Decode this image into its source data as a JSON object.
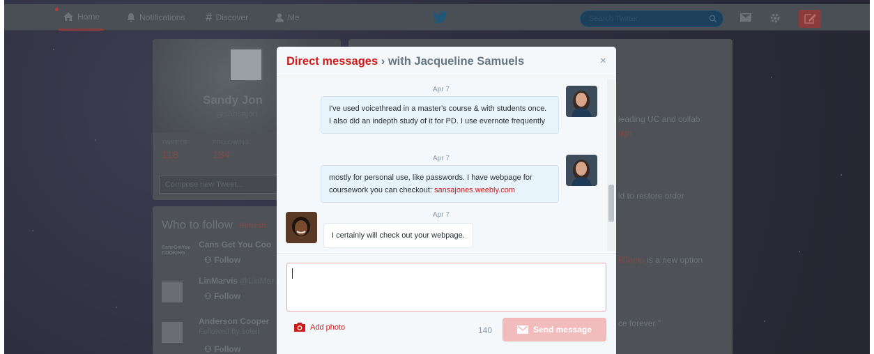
{
  "nav": {
    "items": [
      {
        "label": "Home",
        "icon": "home-icon"
      },
      {
        "label": "Notifications",
        "icon": "bell-icon"
      },
      {
        "label": "Discover",
        "icon": "hash-icon"
      },
      {
        "label": "Me",
        "icon": "person-icon"
      }
    ],
    "search_placeholder": "Search Twitter"
  },
  "profile": {
    "name": "Sandy Jon",
    "handle": "@sansajon",
    "stats": [
      {
        "label": "TWEETS",
        "value": "118"
      },
      {
        "label": "FOLLOWING",
        "value": "184"
      }
    ],
    "compose_placeholder": "Compose new Tweet..."
  },
  "who_to_follow": {
    "title": "Who to follow",
    "refresh": "Refresh",
    "items": [
      {
        "name": "Cans Get You Coo",
        "sub": "",
        "follow": "Follow",
        "avatar_text": "CansGetYou COOKING"
      },
      {
        "name": "LinMarvis",
        "sub": "@LinMar",
        "follow": "Follow"
      },
      {
        "name": "Anderson Cooper",
        "sub": "Followed by soleil",
        "follow": "Follow"
      }
    ]
  },
  "timeline": {
    "fragments": [
      {
        "text": "leading UC and collab"
      },
      {
        "text": "ugh"
      },
      {
        "text": "ld to restore order"
      },
      {
        "text": "RTamp",
        "suffix": " is a new option"
      },
      {
        "text": "ce forever \""
      }
    ]
  },
  "dm": {
    "title_prefix": "Direct messages",
    "title_separator": " › with ",
    "recipient": "Jacqueline Samuels",
    "close": "×",
    "messages": [
      {
        "date": "Apr 7",
        "direction": "sent",
        "text": "I've used voicethread in a master's course & with students once.  I also did an indepth study of it for PD.  I use evernote frequently"
      },
      {
        "date": "Apr 7",
        "direction": "sent",
        "text": "mostly for personal use, like passwords. I have webpage for coursework you can checkout: ",
        "link": "sansajones.weebly.com"
      },
      {
        "date": "Apr 7",
        "direction": "received",
        "text": "I certainly will check out your webpage."
      }
    ],
    "add_photo": "Add photo",
    "char_count": "140",
    "send_label": "Send message"
  },
  "colors": {
    "accent": "#cf1a1a",
    "send_disabled": "#f3bcbc",
    "bubble_sent": "#e8f4fb"
  }
}
